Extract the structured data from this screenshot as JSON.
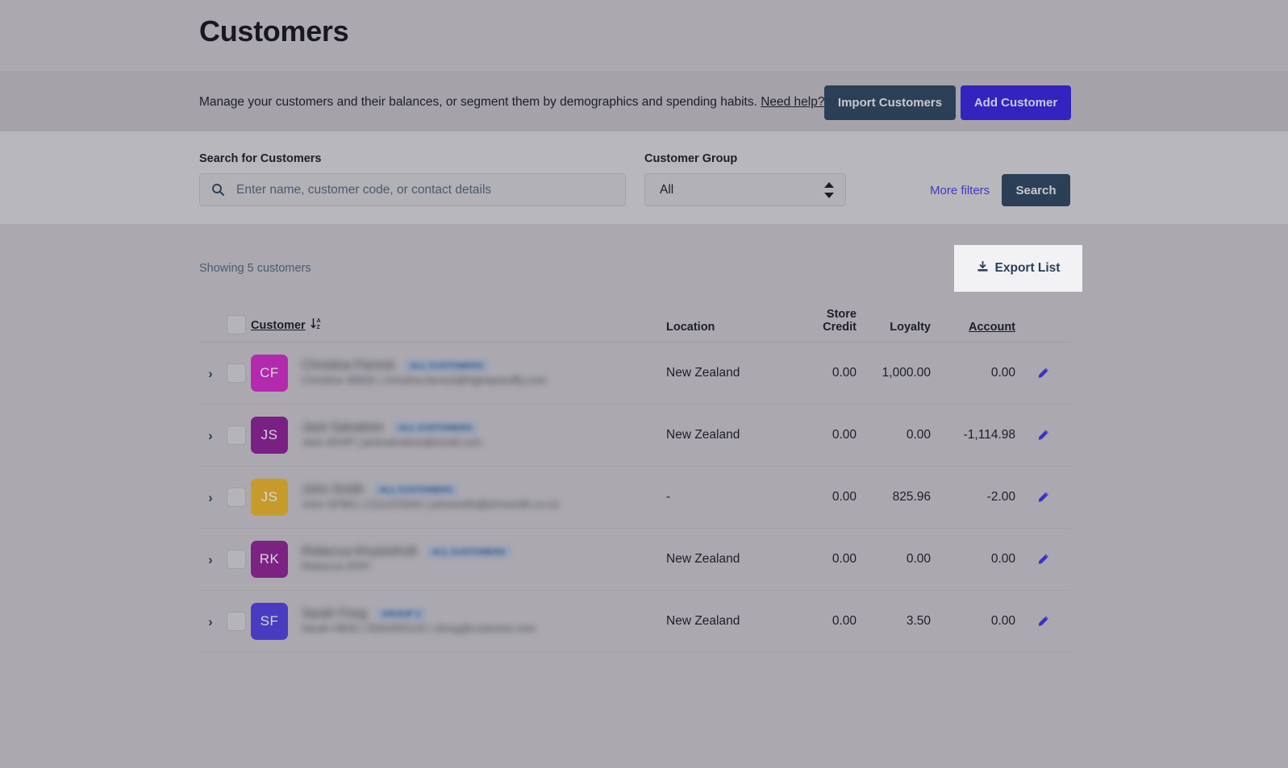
{
  "header": {
    "title": "Customers"
  },
  "description": {
    "text": "Manage your customers and their balances, or segment them by demographics and spending habits.",
    "help_link": "Need help?",
    "external_link_icon": "external-link-icon"
  },
  "actions": {
    "import_label": "Import Customers",
    "add_label": "Add Customer",
    "import_color": "#2b4057",
    "add_color": "#3423be"
  },
  "search": {
    "label": "Search for Customers",
    "placeholder": "Enter name, customer code, or contact details",
    "value": "",
    "icon": "search-icon",
    "group_label": "Customer Group",
    "group_value": "All",
    "group_options": [
      "All"
    ],
    "more_filters_label": "More filters",
    "search_button_label": "Search",
    "link_color": "#4238c4"
  },
  "results": {
    "showing_label": "Showing 5 customers",
    "export_label": "Export List",
    "export_icon": "download-icon"
  },
  "table": {
    "columns": [
      {
        "key": "customer",
        "label": "Customer",
        "sortable": true,
        "sorted": "asc",
        "sort_icon": "sort-az-descending-icon"
      },
      {
        "key": "location",
        "label": "Location",
        "sortable": false
      },
      {
        "key": "store_credit",
        "label": "Store Credit",
        "sortable": false
      },
      {
        "key": "loyalty",
        "label": "Loyalty",
        "sortable": false
      },
      {
        "key": "account",
        "label": "Account",
        "sortable": true
      }
    ],
    "select_all_checkbox": false,
    "rows": [
      {
        "initials": "CF",
        "avatar_color": "#b32aae",
        "name": "Christina Parrest",
        "tag": "ALL CUSTOMERS",
        "subtitle": "Christine 48832 | christina.farrest@highspeedfly.com",
        "location": "New Zealand",
        "store_credit": "0.00",
        "loyalty": "1,000.00",
        "account": "0.00",
        "edit_icon": "pencil-icon",
        "expand_icon": "chevron-right-icon",
        "checked": false
      },
      {
        "initials": "JS",
        "avatar_color": "#7a2084",
        "name": "Jack Salvatore",
        "tag": "ALL CUSTOMERS",
        "subtitle": "Jack 4DHP | jacksalvatore@email.com",
        "location": "New Zealand",
        "store_credit": "0.00",
        "loyalty": "0.00",
        "account": "-1,114.98",
        "edit_icon": "pencil-icon",
        "expand_icon": "chevron-right-icon",
        "checked": false
      },
      {
        "initials": "JS",
        "avatar_color": "#c69b2a",
        "name": "John Smith",
        "tag": "ALL CUSTOMERS",
        "subtitle": "John GFBG | 2111223344 | johnsmith@johnsmith.co.nz",
        "location": "-",
        "store_credit": "0.00",
        "loyalty": "825.96",
        "account": "-2.00",
        "edit_icon": "pencil-icon",
        "expand_icon": "chevron-right-icon",
        "checked": false
      },
      {
        "initials": "RK",
        "avatar_color": "#7c2282",
        "name": "Rebecca Khutsishvili",
        "tag": "ALL CUSTOMERS",
        "subtitle": "Rebecca 2F8Y",
        "location": "New Zealand",
        "store_credit": "0.00",
        "loyalty": "0.00",
        "account": "0.00",
        "edit_icon": "pencil-icon",
        "expand_icon": "chevron-right-icon",
        "checked": false
      },
      {
        "initials": "SF",
        "avatar_color": "#4a3cc0",
        "name": "Sarah Fong",
        "tag": "GROUP 1",
        "subtitle": "Sarah HB32 | 0563355123 | sfong@customer.com",
        "location": "New Zealand",
        "store_credit": "0.00",
        "loyalty": "3.50",
        "account": "0.00",
        "edit_icon": "pencil-icon",
        "expand_icon": "chevron-right-icon",
        "checked": false
      }
    ]
  }
}
